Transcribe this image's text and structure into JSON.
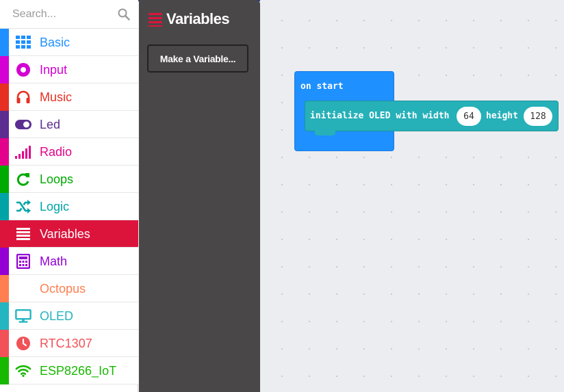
{
  "search": {
    "placeholder": "Search..."
  },
  "categories": [
    {
      "label": "Basic",
      "color": "#1e90ff",
      "icon": "grid-icon"
    },
    {
      "label": "Input",
      "color": "#d400d4",
      "icon": "record-icon"
    },
    {
      "label": "Music",
      "color": "#e63022",
      "icon": "headphones-icon"
    },
    {
      "label": "Led",
      "color": "#5c2d91",
      "icon": "toggle-icon"
    },
    {
      "label": "Radio",
      "color": "#e3008c",
      "icon": "signal-bars-icon"
    },
    {
      "label": "Loops",
      "color": "#00aa00",
      "icon": "refresh-icon"
    },
    {
      "label": "Logic",
      "color": "#00a4a6",
      "icon": "shuffle-icon"
    },
    {
      "label": "Variables",
      "color": "#dc143c",
      "icon": "list-lines-icon"
    },
    {
      "label": "Math",
      "color": "#9400d3",
      "icon": "calculator-icon"
    },
    {
      "label": "Octopus",
      "color": "#ff7f50",
      "icon": ""
    },
    {
      "label": "OLED",
      "color": "#23b5c0",
      "icon": "monitor-icon"
    },
    {
      "label": "RTC1307",
      "color": "#f25157",
      "icon": "clock-icon"
    },
    {
      "label": "ESP8266_IoT",
      "color": "#17b800",
      "icon": "wifi-icon"
    }
  ],
  "selected_category": "Variables",
  "flyout": {
    "title": "Variables",
    "make_variable_label": "Make a Variable..."
  },
  "workspace": {
    "on_start": {
      "label": "on start"
    },
    "init_block": {
      "label_prefix": "initialize OLED with width",
      "width_value": "64",
      "label_height": "height",
      "height_value": "128"
    }
  },
  "colors": {
    "accent_selected": "#dc143c",
    "flyout_bg": "#4a4748",
    "on_start_block": "#1e90ff",
    "oled_block": "#26b0b8"
  }
}
